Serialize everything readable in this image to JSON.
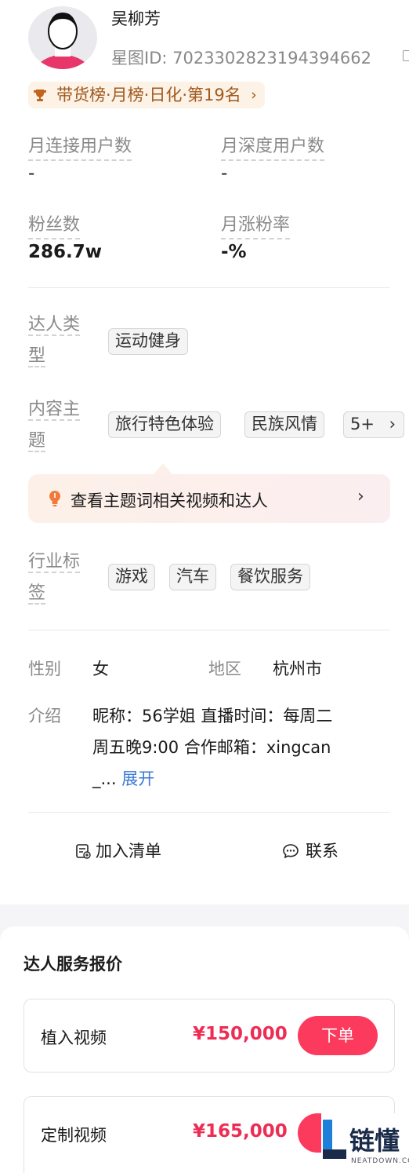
{
  "profile": {
    "name": "吴柳芳",
    "star_id": "星图ID: 7023302823194394662",
    "rank_badge": "带货榜·月榜·日化·第19名"
  },
  "metrics": [
    {
      "label": "月连接用户数",
      "value": "-"
    },
    {
      "label": "月深度用户数",
      "value": "-"
    },
    {
      "label": "粉丝数",
      "value": "286.7w"
    },
    {
      "label": "月涨粉率",
      "value": "-%"
    }
  ],
  "tags": {
    "creator_type": {
      "label_line1": "达人类",
      "label_line2": "型",
      "items": [
        "运动健身"
      ]
    },
    "content_topic": {
      "label_line1": "内容主",
      "label_line2": "题",
      "items": [
        "旅行特色体验",
        "民族风情"
      ],
      "more": "5+"
    },
    "industry": {
      "label_line1": "行业标",
      "label_line2": "签",
      "items": [
        "游戏",
        "汽车",
        "餐饮服务"
      ]
    }
  },
  "topic_tip": "查看主题词相关视频和达人",
  "info": {
    "gender_label": "性别",
    "gender": "女",
    "region_label": "地区",
    "region": "杭州市",
    "intro_label": "介绍",
    "intro_line1": "昵称：56学姐 直播时间：每周二",
    "intro_line2": "周五晚9:00 合作邮箱：xingcan",
    "intro_line3": "_...",
    "expand": "展开"
  },
  "actions": {
    "add_list": "加入清单",
    "contact": "联系"
  },
  "pricing": {
    "title": "达人服务报价",
    "items": [
      {
        "name": "植入视频",
        "price": "¥150,000",
        "button": "下单"
      },
      {
        "name": "定制视频",
        "price": "¥165,000",
        "button": "下单"
      }
    ]
  },
  "watermark": {
    "text": "链懂",
    "sub": "NEATDOWN.COM"
  },
  "colors": {
    "accent": "#fc3a5e",
    "price": "#ee2d55",
    "rank_text": "#a0591e",
    "link": "#3a7ad6"
  }
}
